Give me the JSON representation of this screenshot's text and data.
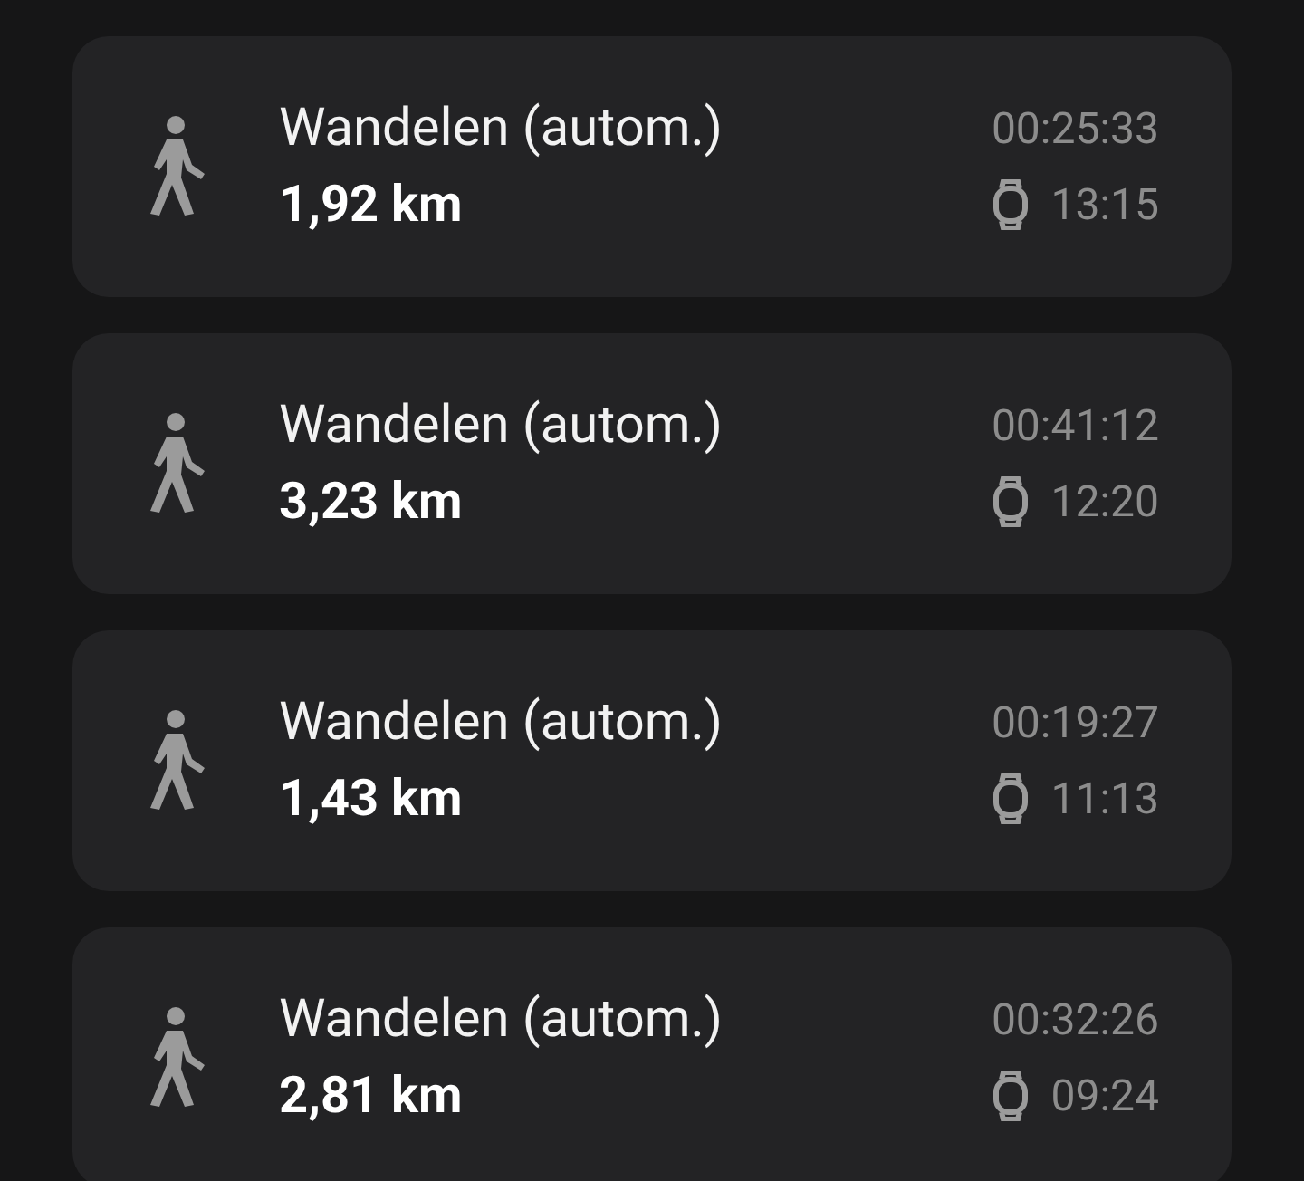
{
  "activities": [
    {
      "title": "Wandelen (autom.)",
      "distance": "1,92 km",
      "duration": "00:25:33",
      "time": "13:15"
    },
    {
      "title": "Wandelen (autom.)",
      "distance": "3,23 km",
      "duration": "00:41:12",
      "time": "12:20"
    },
    {
      "title": "Wandelen (autom.)",
      "distance": "1,43 km",
      "duration": "00:19:27",
      "time": "11:13"
    },
    {
      "title": "Wandelen (autom.)",
      "distance": "2,81 km",
      "duration": "00:32:26",
      "time": "09:24"
    }
  ]
}
